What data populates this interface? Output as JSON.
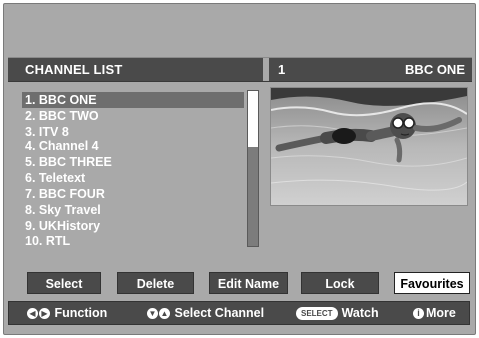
{
  "header": {
    "title": "CHANNEL LIST",
    "channel_number": "1",
    "channel_name": "BBC ONE"
  },
  "channel_list": {
    "items": [
      {
        "label": "1. BBC ONE",
        "selected": true
      },
      {
        "label": "2. BBC TWO",
        "selected": false
      },
      {
        "label": "3. ITV 8",
        "selected": false
      },
      {
        "label": "4. Channel 4",
        "selected": false
      },
      {
        "label": "5. BBC THREE",
        "selected": false
      },
      {
        "label": "6. Teletext",
        "selected": false
      },
      {
        "label": "7. BBC FOUR",
        "selected": false
      },
      {
        "label": "8. Sky Travel",
        "selected": false
      },
      {
        "label": "9. UKHistory",
        "selected": false
      },
      {
        "label": "10. RTL",
        "selected": false
      }
    ]
  },
  "buttons": {
    "select": "Select",
    "delete": "Delete",
    "edit_name": "Edit Name",
    "lock": "Lock",
    "favourites": "Favourites"
  },
  "hints": {
    "function": "Function",
    "select_channel": "Select Channel",
    "select_key": "SELECT",
    "watch": "Watch",
    "info_key": "i",
    "more": "More"
  },
  "icons": {
    "left_arrow": "◀",
    "right_arrow": "▶",
    "down_arrow": "▼",
    "up_arrow": "▲"
  },
  "colors": {
    "background": "#a9a9a9",
    "bar": "#4a4a4a",
    "selected_row": "#6e6e6e",
    "active_button": "#ffffff"
  }
}
